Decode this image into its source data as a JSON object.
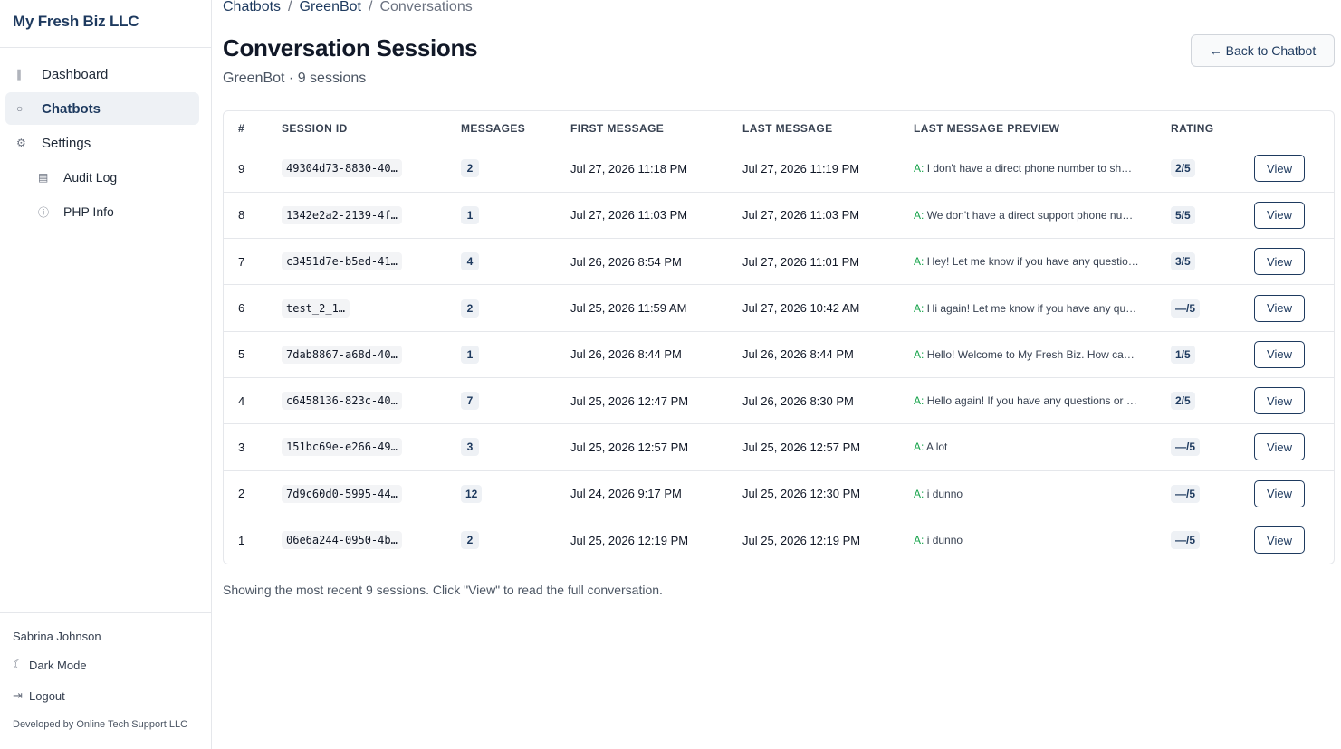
{
  "brand": "My Fresh Biz LLC",
  "nav": [
    {
      "label": "Dashboard",
      "icon": "bar-chart-icon",
      "glyph": "∥",
      "active": false
    },
    {
      "label": "Chatbots",
      "icon": "chat-bubble-icon",
      "glyph": "○",
      "active": true
    },
    {
      "label": "Settings",
      "icon": "gear-icon",
      "glyph": "⚙",
      "active": false
    },
    {
      "label": "Audit Log",
      "icon": "document-icon",
      "glyph": "▤",
      "active": false,
      "sub": true
    },
    {
      "label": "PHP Info",
      "icon": "info-icon",
      "glyph": "ⓘ",
      "active": false,
      "sub": true
    }
  ],
  "footer": {
    "user": "Sabrina Johnson",
    "dark_mode": "Dark Mode",
    "logout": "Logout",
    "credit": "Developed by Online Tech Support LLC"
  },
  "breadcrumb": {
    "first": "Chatbots",
    "second": "GreenBot",
    "current": "Conversations"
  },
  "page": {
    "title": "Conversation Sessions",
    "subtitle": "GreenBot · 9 sessions",
    "back_label": "← Back to Chatbot"
  },
  "table": {
    "headers": [
      "#",
      "SESSION ID",
      "MESSAGES",
      "FIRST MESSAGE",
      "LAST MESSAGE",
      "LAST MESSAGE PREVIEW",
      "RATING",
      ""
    ],
    "action_label": "View",
    "rows": [
      {
        "num": "9",
        "sid": "49304d73-8830-40…",
        "messages": "2",
        "first": "Jul 27, 2026 11:18 PM",
        "last": "Jul 27, 2026 11:19 PM",
        "who": "A:",
        "preview": "I don't have a direct phone number to sh…",
        "rating": "2/5"
      },
      {
        "num": "8",
        "sid": "1342e2a2-2139-4f…",
        "messages": "1",
        "first": "Jul 27, 2026 11:03 PM",
        "last": "Jul 27, 2026 11:03 PM",
        "who": "A:",
        "preview": "We don't have a direct support phone nu…",
        "rating": "5/5"
      },
      {
        "num": "7",
        "sid": "c3451d7e-b5ed-41…",
        "messages": "4",
        "first": "Jul 26, 2026 8:54 PM",
        "last": "Jul 27, 2026 11:01 PM",
        "who": "A:",
        "preview": "Hey! Let me know if you have any questio…",
        "rating": "3/5"
      },
      {
        "num": "6",
        "sid": "test_2_1…",
        "messages": "2",
        "first": "Jul 25, 2026 11:59 AM",
        "last": "Jul 27, 2026 10:42 AM",
        "who": "A:",
        "preview": "Hi again! Let me know if you have any qu…",
        "rating": "—/5"
      },
      {
        "num": "5",
        "sid": "7dab8867-a68d-40…",
        "messages": "1",
        "first": "Jul 26, 2026 8:44 PM",
        "last": "Jul 26, 2026 8:44 PM",
        "who": "A:",
        "preview": "Hello! Welcome to My Fresh Biz. How ca…",
        "rating": "1/5"
      },
      {
        "num": "4",
        "sid": "c6458136-823c-40…",
        "messages": "7",
        "first": "Jul 25, 2026 12:47 PM",
        "last": "Jul 26, 2026 8:30 PM",
        "who": "A:",
        "preview": "Hello again! If you have any questions or …",
        "rating": "2/5"
      },
      {
        "num": "3",
        "sid": "151bc69e-e266-49…",
        "messages": "3",
        "first": "Jul 25, 2026 12:57 PM",
        "last": "Jul 25, 2026 12:57 PM",
        "who": "A:",
        "preview": "A lot",
        "rating": "—/5"
      },
      {
        "num": "2",
        "sid": "7d9c60d0-5995-44…",
        "messages": "12",
        "first": "Jul 24, 2026 9:17 PM",
        "last": "Jul 25, 2026 12:30 PM",
        "who": "A:",
        "preview": "i dunno",
        "rating": "—/5"
      },
      {
        "num": "1",
        "sid": "06e6a244-0950-4b…",
        "messages": "2",
        "first": "Jul 25, 2026 12:19 PM",
        "last": "Jul 25, 2026 12:19 PM",
        "who": "A:",
        "preview": "i dunno",
        "rating": "—/5"
      }
    ]
  },
  "footnote": "Showing the most recent 9 sessions. Click \"View\" to read the full conversation."
}
